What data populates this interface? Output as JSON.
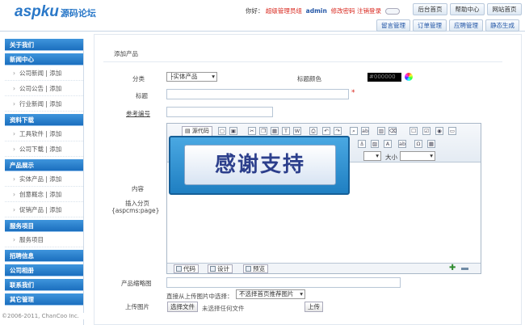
{
  "logo": {
    "brand": "aspku",
    "cn": "源码论坛"
  },
  "user": {
    "greeting": "你好：",
    "role": "超级管理员组",
    "name": "admin",
    "change_pw": "修改密码",
    "logout": "注销登录"
  },
  "top_buttons": [
    "后台首页",
    "帮助中心",
    "网站首页"
  ],
  "sub_buttons": [
    "留言管理",
    "订单管理",
    "应聘管理",
    "静态生成"
  ],
  "sidebar": {
    "about": "关于我们",
    "news": "新闻中心",
    "news_items": [
      "公司新闻 | 添加",
      "公司公告 | 添加",
      "行业新闻 | 添加"
    ],
    "dl": "资料下载",
    "dl_items": [
      "工具软件 | 添加",
      "公司下载 | 添加"
    ],
    "prod": "产品展示",
    "prod_items": [
      "实体产品 | 添加",
      "创意概念 | 添加",
      "促销产品 | 添加"
    ],
    "svc": "服务项目",
    "svc_items": [
      "服务项目"
    ],
    "jobs": "招聘信息",
    "album": "公司相册",
    "contact": "联系我们",
    "other": "其它管理"
  },
  "copyright": "©2006-2011, ChanCoo Inc.",
  "form": {
    "page_title": "添加产品",
    "category_label": "分类",
    "category_value": "├实体产品",
    "title_color_label": "标题颜色",
    "title_color_value": "#000000",
    "title_label": "标题",
    "ref_label": "参考编号",
    "content_label": "内容",
    "pagebreak_label": "插入分页",
    "pagebreak_code": "{aspcms:page}",
    "source_btn": "源代码",
    "size_label": "大小",
    "banner_text": "感谢支持",
    "tab_code": "代码",
    "tab_design": "设计",
    "tab_preview": "预览",
    "thumb_label": "产品缩略图",
    "direct_label": "直接从上传图片中选择：",
    "direct_select": "不选择首页推荐图片",
    "upload_label": "上传图片",
    "choose_file": "选择文件",
    "no_file": "未选择任何文件",
    "upload_btn": "上传"
  },
  "colors": {
    "accent": "#1b6fbf",
    "red": "#d8261c"
  }
}
